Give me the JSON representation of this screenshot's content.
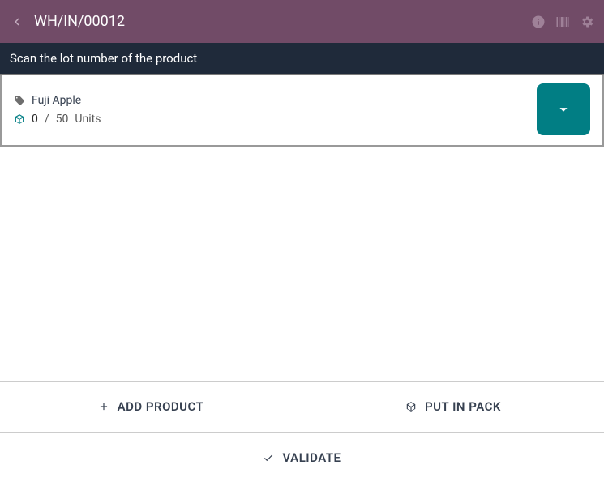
{
  "header": {
    "title": "WH/IN/00012",
    "icons": [
      "info",
      "barcode",
      "settings"
    ]
  },
  "instruction": "Scan the lot number of the product",
  "line": {
    "product_name": "Fuji Apple",
    "qty_done": "0",
    "qty_separator": "/",
    "qty_demand": "50",
    "uom": "Units"
  },
  "footer": {
    "add_product": "ADD PRODUCT",
    "put_in_pack": "PUT IN PACK",
    "validate": "VALIDATE"
  }
}
